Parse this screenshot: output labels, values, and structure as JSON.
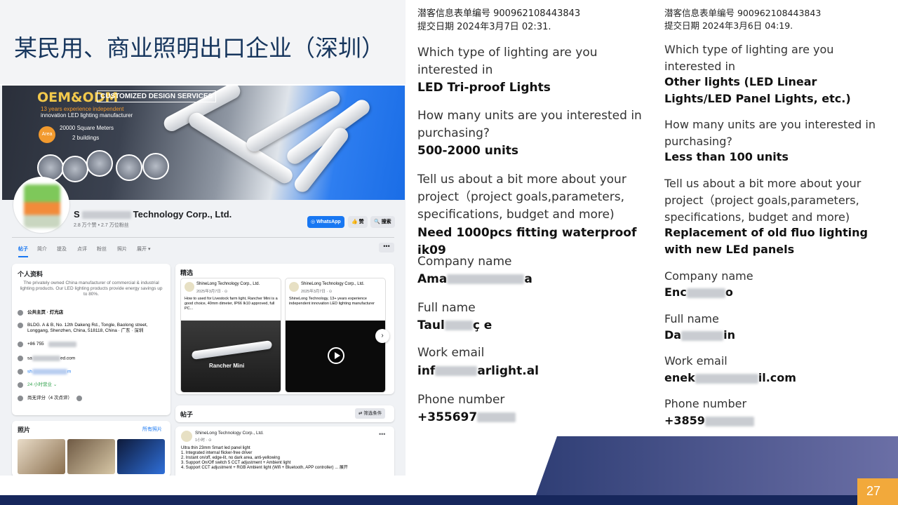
{
  "slide": {
    "title": "某民用、商业照明出口企业（深圳）",
    "page_number": "27",
    "colors": {
      "title": "#17365d",
      "footer": "#17275c",
      "page_badge": "#f2a93b"
    }
  },
  "fb_page": {
    "cover": {
      "headline": "OEM&ODM",
      "badge": "CUSTOMIZED DESIGN SERVICES",
      "sub1": "13 years experience independent",
      "sub2": "innovation LED lighting manufacturer",
      "area_label": "Area",
      "area": "20000 Square Meters",
      "buildings": "2 buildings"
    },
    "name_prefix": "S",
    "name_suffix": "Technology Corp., Ltd.",
    "stats": "2.8 万个赞 • 2.7 万位粉丝",
    "buttons": {
      "whatsapp": "WhatsApp",
      "like": "赞",
      "search": "搜索"
    },
    "tabs": [
      "帖子",
      "简介",
      "提及",
      "点评",
      "粉丝",
      "照片",
      "展开 ▾"
    ],
    "more": "•••",
    "intro": {
      "title": "个人资料",
      "description": "The privately owned China manufacturer of commercial & industrial lighting products. Our LED lighting products provide energy savings up to 80%.",
      "category": "公共主页 · 灯光店",
      "address": "BLDG. A & B, No. 12th Dakeng Rd., Tongle, Baolong street, Longgang, Shenzhen, China, 518118, China · 广东 · 深圳",
      "phone": "+86 755",
      "email_prefix": "sa",
      "email_suffix": "ed.com",
      "website_prefix": "sh",
      "website_suffix": "m",
      "hours": "24 小时营业 ⌄",
      "rating": "尚无评分（4 次点评）"
    },
    "photos": {
      "title": "照片",
      "all": "所有照片"
    },
    "featured": {
      "title": "精选",
      "posts": [
        {
          "author": "ShineLong Technology Corp., Ltd.",
          "date": "2025年3月7日 · ⊙",
          "text": "How to used for Livestock farm light, Rancher Mini is a good choice, 40mm dimeter, IP66 Ik10 approved, full PC...",
          "image_label": "Rancher Mini"
        },
        {
          "author": "ShineLong Technology Corp., Ltd.",
          "date": "2025年3月7日 · ⊙",
          "text": "ShineLong Technology, 13+ years experience independent innovation LED lighting manufacturer",
          "image_label": ""
        }
      ],
      "next": "›"
    },
    "posts": {
      "title": "帖子",
      "filter": "⇄ 筛选条件"
    },
    "post": {
      "author": "ShineLong Technology Corp., Ltd.",
      "time": "1小时 · ⊙",
      "dots": "•••",
      "body": "Ultra thin 23mm Smart led panel light\n1. Integrated internal flicker-free driver\n2. Instant on/off, edge-lit, no dark area, anti-yellowing\n3. Support On/Off switch 5 CCT adjustment + Ambient light\n4. Support CCT adjustment + RGB Ambient light (Wifi + Bluetooth, APP controller) ... 展开"
    }
  },
  "forms": [
    {
      "form_id": "潜客信息表单编号 900962108443843",
      "submitted": "提交日期 2024年3月7日 02:31.",
      "q1": "Which type of lighting are you interested in",
      "a1": "LED Tri-proof Lights",
      "q2": "How many units are you interested in purchasing?",
      "a2": "500-2000 units",
      "q3": "Tell us about a bit more about your project（project goals,parameters, specifications, budget and more)",
      "a3": "Need 1000pcs fitting waterproof ik09",
      "q_company": "Company name",
      "company_prefix": "Ama",
      "company_suffix": "a",
      "q_name": "Full name",
      "name_prefix": "Taul",
      "name_suffix": "ç e",
      "q_email": "Work email",
      "email_prefix": "inf",
      "email_suffix": "arlight.al",
      "q_phone": "Phone number",
      "phone_prefix": "+355697"
    },
    {
      "form_id": "潜客信息表单编号 900962108443843",
      "submitted": "提交日期 2024年3月6日 04:19.",
      "q1": "Which type of lighting are you interested in",
      "a1": "Other lights (LED Linear Lights/LED Panel Lights, etc.)",
      "q2": "How many units are you interested in purchasing?",
      "a2": "Less than 100 units",
      "q3": "Tell us about a bit more about your project（project goals,parameters, specifications, budget and more)",
      "a3": "Replacement of old fluo lighting with new LEd panels",
      "q_company": "Company name",
      "company_prefix": "Enc",
      "company_suffix": "o",
      "q_name": "Full name",
      "name_prefix": "Da",
      "name_suffix": "in",
      "q_email": "Work email",
      "email_prefix": "enek",
      "email_suffix": "il.com",
      "q_phone": "Phone number",
      "phone_prefix": "+3859"
    }
  ]
}
